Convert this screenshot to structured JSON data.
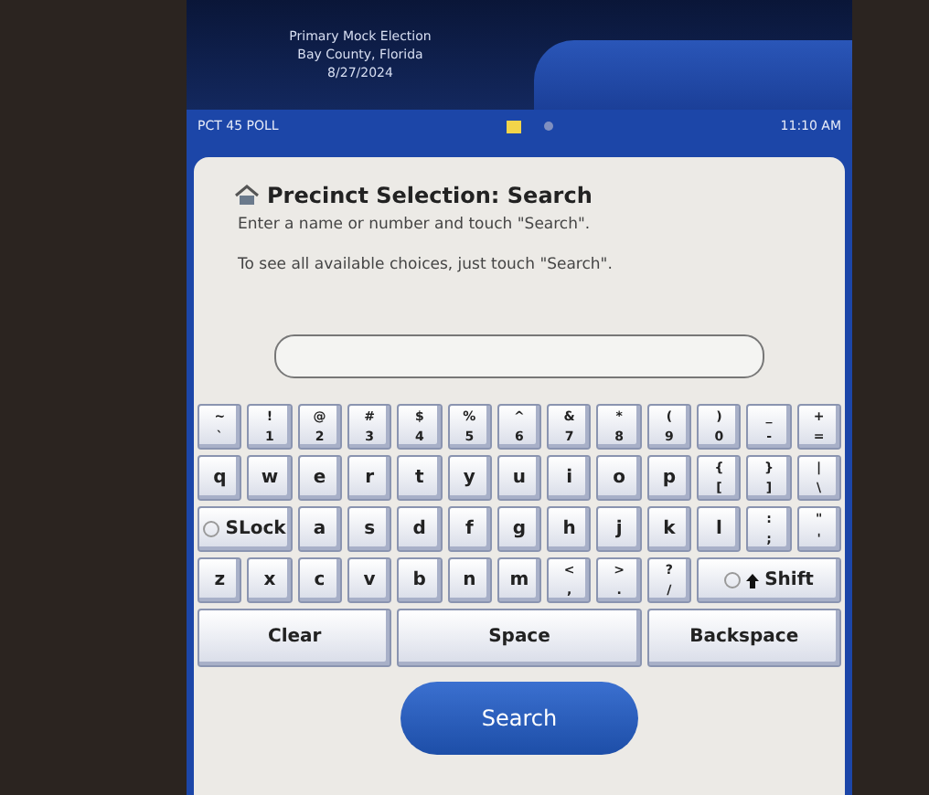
{
  "header": {
    "lines": [
      "Primary Mock Election",
      "Bay County, Florida",
      "8/27/2024"
    ]
  },
  "status_bar": {
    "poll": "PCT 45 POLL",
    "time": "11:10 AM"
  },
  "screen": {
    "title": "Precinct Selection: Search",
    "instructions": [
      "Enter a name or number and touch \"Search\".",
      "To see all available choices, just touch \"Search\"."
    ]
  },
  "keyboard": [
    [
      {
        "kind": "dual",
        "upper": "~",
        "lower": "`"
      },
      {
        "kind": "dual",
        "upper": "!",
        "lower": "1"
      },
      {
        "kind": "dual",
        "upper": "@",
        "lower": "2"
      },
      {
        "kind": "dual",
        "upper": "#",
        "lower": "3"
      },
      {
        "kind": "dual",
        "upper": "$",
        "lower": "4"
      },
      {
        "kind": "dual",
        "upper": "%",
        "lower": "5"
      },
      {
        "kind": "dual",
        "upper": "^",
        "lower": "6"
      },
      {
        "kind": "dual",
        "upper": "&",
        "lower": "7"
      },
      {
        "kind": "dual",
        "upper": "*",
        "lower": "8"
      },
      {
        "kind": "dual",
        "upper": "(",
        "lower": "9"
      },
      {
        "kind": "dual",
        "upper": ")",
        "lower": "0"
      },
      {
        "kind": "dual",
        "upper": "_",
        "lower": "-"
      },
      {
        "kind": "dual",
        "upper": "+",
        "lower": "="
      }
    ],
    [
      {
        "kind": "letter",
        "label": "q"
      },
      {
        "kind": "letter",
        "label": "w"
      },
      {
        "kind": "letter",
        "label": "e"
      },
      {
        "kind": "letter",
        "label": "r"
      },
      {
        "kind": "letter",
        "label": "t"
      },
      {
        "kind": "letter",
        "label": "y"
      },
      {
        "kind": "letter",
        "label": "u"
      },
      {
        "kind": "letter",
        "label": "i"
      },
      {
        "kind": "letter",
        "label": "o"
      },
      {
        "kind": "letter",
        "label": "p"
      },
      {
        "kind": "dual",
        "upper": "{",
        "lower": "["
      },
      {
        "kind": "dual",
        "upper": "}",
        "lower": "]"
      },
      {
        "kind": "dual",
        "upper": "|",
        "lower": "\\"
      }
    ],
    [
      {
        "kind": "toggle",
        "label": "SLock",
        "on": false
      },
      {
        "kind": "letter",
        "label": "a"
      },
      {
        "kind": "letter",
        "label": "s"
      },
      {
        "kind": "letter",
        "label": "d"
      },
      {
        "kind": "letter",
        "label": "f"
      },
      {
        "kind": "letter",
        "label": "g"
      },
      {
        "kind": "letter",
        "label": "h"
      },
      {
        "kind": "letter",
        "label": "j"
      },
      {
        "kind": "letter",
        "label": "k"
      },
      {
        "kind": "letter",
        "label": "l"
      },
      {
        "kind": "dual",
        "upper": ":",
        "lower": ";"
      },
      {
        "kind": "dual",
        "upper": "\"",
        "lower": "'"
      }
    ],
    [
      {
        "kind": "letter",
        "label": "z"
      },
      {
        "kind": "letter",
        "label": "x"
      },
      {
        "kind": "letter",
        "label": "c"
      },
      {
        "kind": "letter",
        "label": "v"
      },
      {
        "kind": "letter",
        "label": "b"
      },
      {
        "kind": "letter",
        "label": "n"
      },
      {
        "kind": "letter",
        "label": "m"
      },
      {
        "kind": "dual",
        "upper": "<",
        "lower": ","
      },
      {
        "kind": "dual",
        "upper": ">",
        "lower": "."
      },
      {
        "kind": "dual",
        "upper": "?",
        "lower": "/"
      },
      {
        "kind": "shift",
        "label": "Shift",
        "on": false
      }
    ],
    [
      {
        "kind": "wide",
        "label": "Clear"
      },
      {
        "kind": "wide",
        "label": "Space"
      },
      {
        "kind": "wide",
        "label": "Backspace"
      }
    ]
  ],
  "search_button": {
    "label": "Search"
  }
}
